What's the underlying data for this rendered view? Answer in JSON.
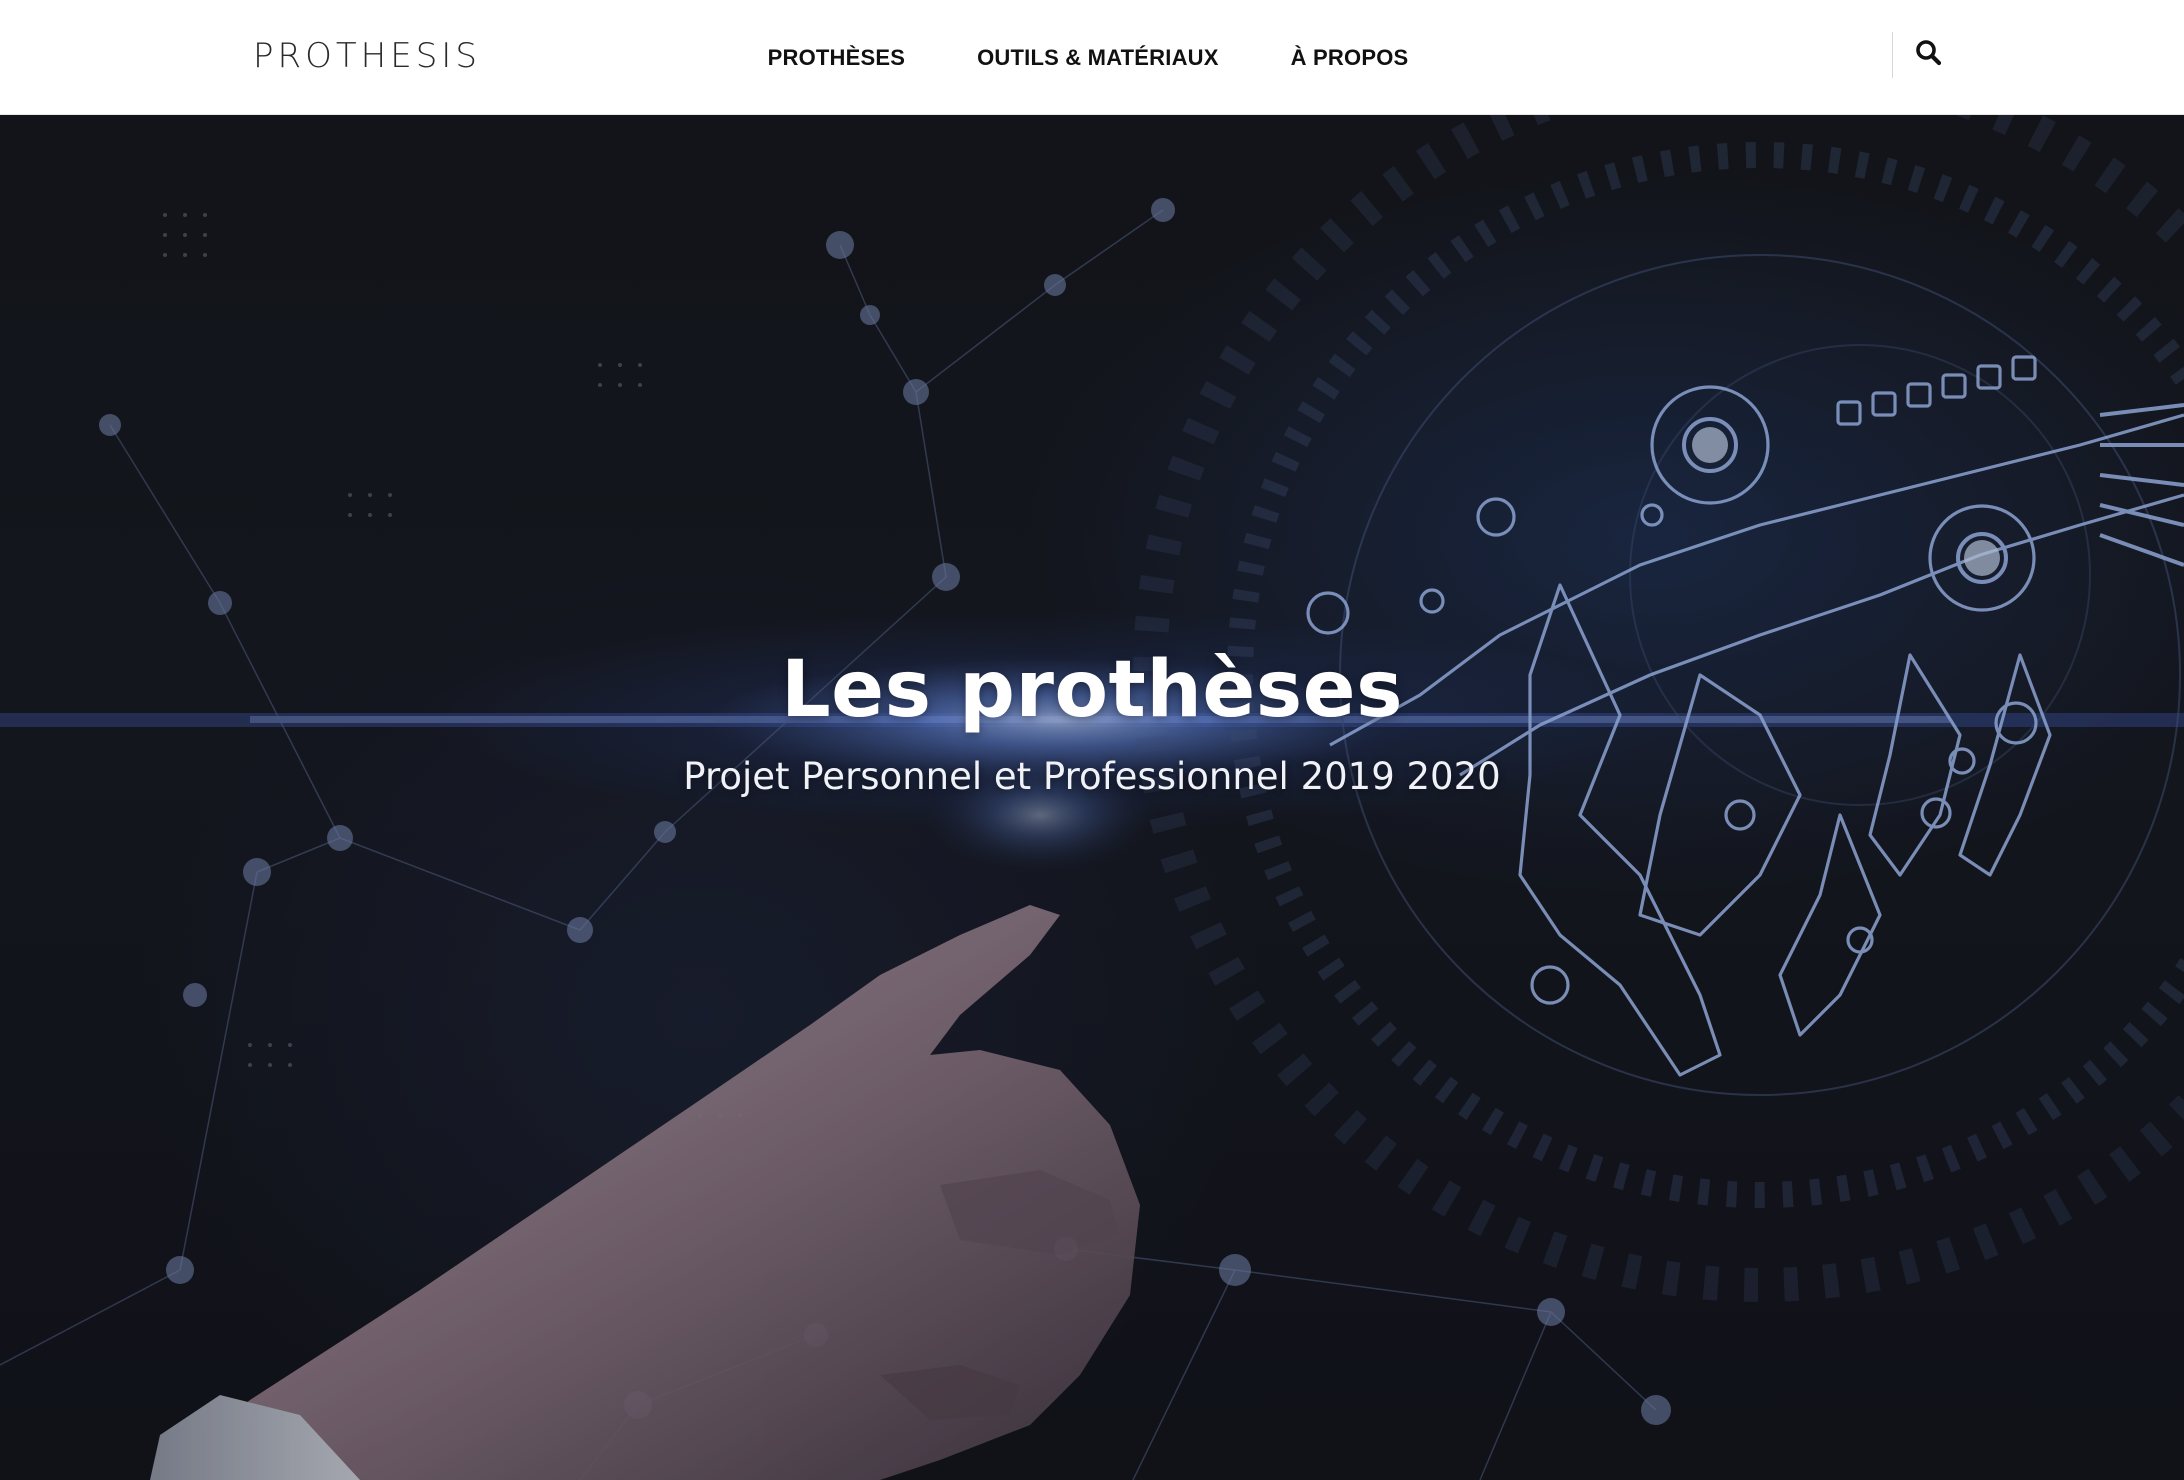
{
  "header": {
    "logo": "PROTHESIS",
    "nav": [
      {
        "label": "PROTHÈSES"
      },
      {
        "label": "OUTILS & MATÉRIAUX"
      },
      {
        "label": "À PROPOS"
      }
    ],
    "search_icon": "search-icon"
  },
  "hero": {
    "title": "Les prothèses",
    "subtitle": "Projet Personnel et Professionnel 2019 2020",
    "image": "human-hand-touching-robotic-hand",
    "accent_color": "#6f9bff"
  }
}
